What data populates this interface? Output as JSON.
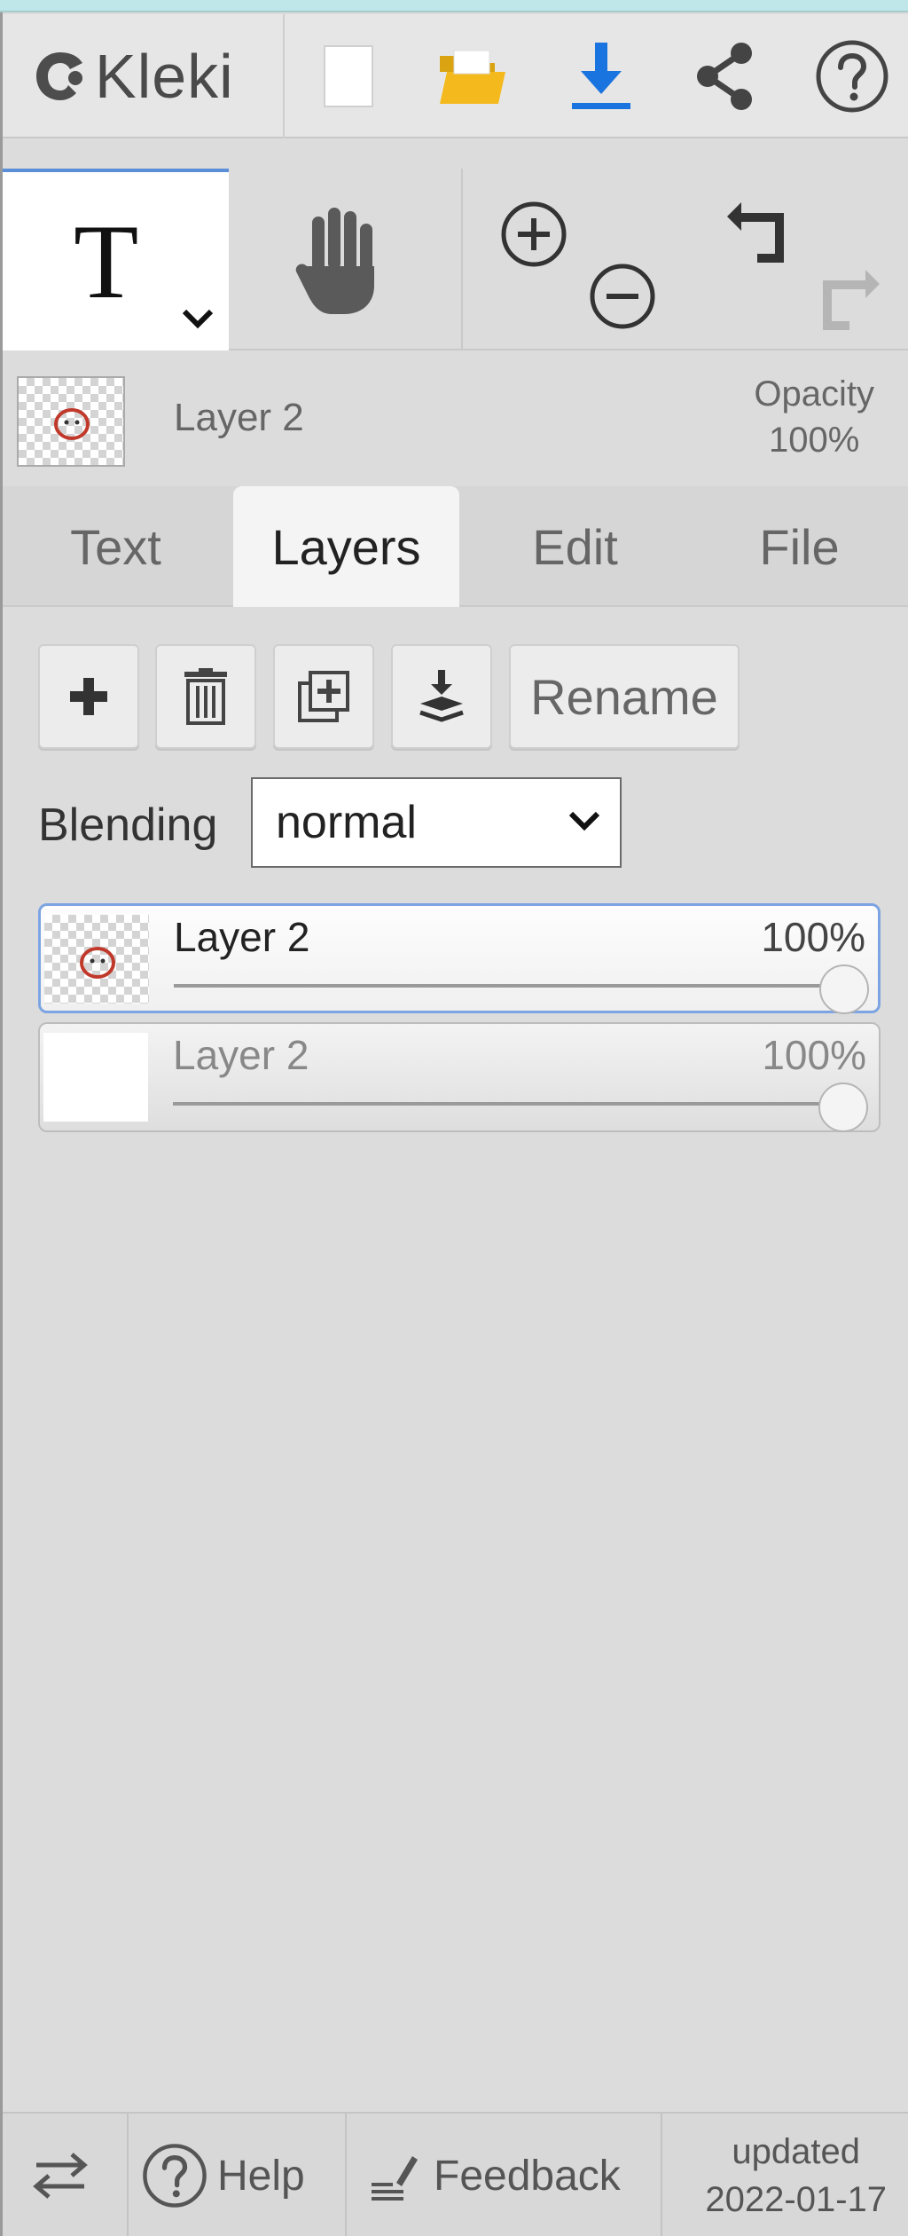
{
  "app": {
    "name": "Kleki"
  },
  "menu": {
    "new_icon": "new-file-icon",
    "open_icon": "open-folder-icon",
    "save_icon": "download-icon",
    "share_icon": "share-icon",
    "help_icon": "help-icon",
    "accent_color": "#1a74e0",
    "folder_color": "#f4b91c"
  },
  "toolbar": {
    "active_tool": "T",
    "tools": [
      "text-tool",
      "hand-tool",
      "zoom-in",
      "zoom-out",
      "undo",
      "redo"
    ]
  },
  "layer_info": {
    "name": "Layer 2",
    "opacity_label": "Opacity",
    "opacity_value": "100%"
  },
  "tabs": [
    {
      "label": "Text",
      "active": false
    },
    {
      "label": "Layers",
      "active": true
    },
    {
      "label": "Edit",
      "active": false
    },
    {
      "label": "File",
      "active": false
    }
  ],
  "layers_panel": {
    "actions": {
      "rename_label": "Rename"
    },
    "blending_label": "Blending",
    "blending_value": "normal",
    "layers": [
      {
        "name": "Layer 2",
        "opacity": "100%",
        "opacity_fraction": 1.0,
        "selected": true
      },
      {
        "name": "Layer 2",
        "opacity": "100%",
        "opacity_fraction": 1.0,
        "selected": false
      }
    ]
  },
  "footer": {
    "help_label": "Help",
    "feedback_label": "Feedback",
    "updated_label": "updated",
    "updated_date": "2022-01-17"
  }
}
